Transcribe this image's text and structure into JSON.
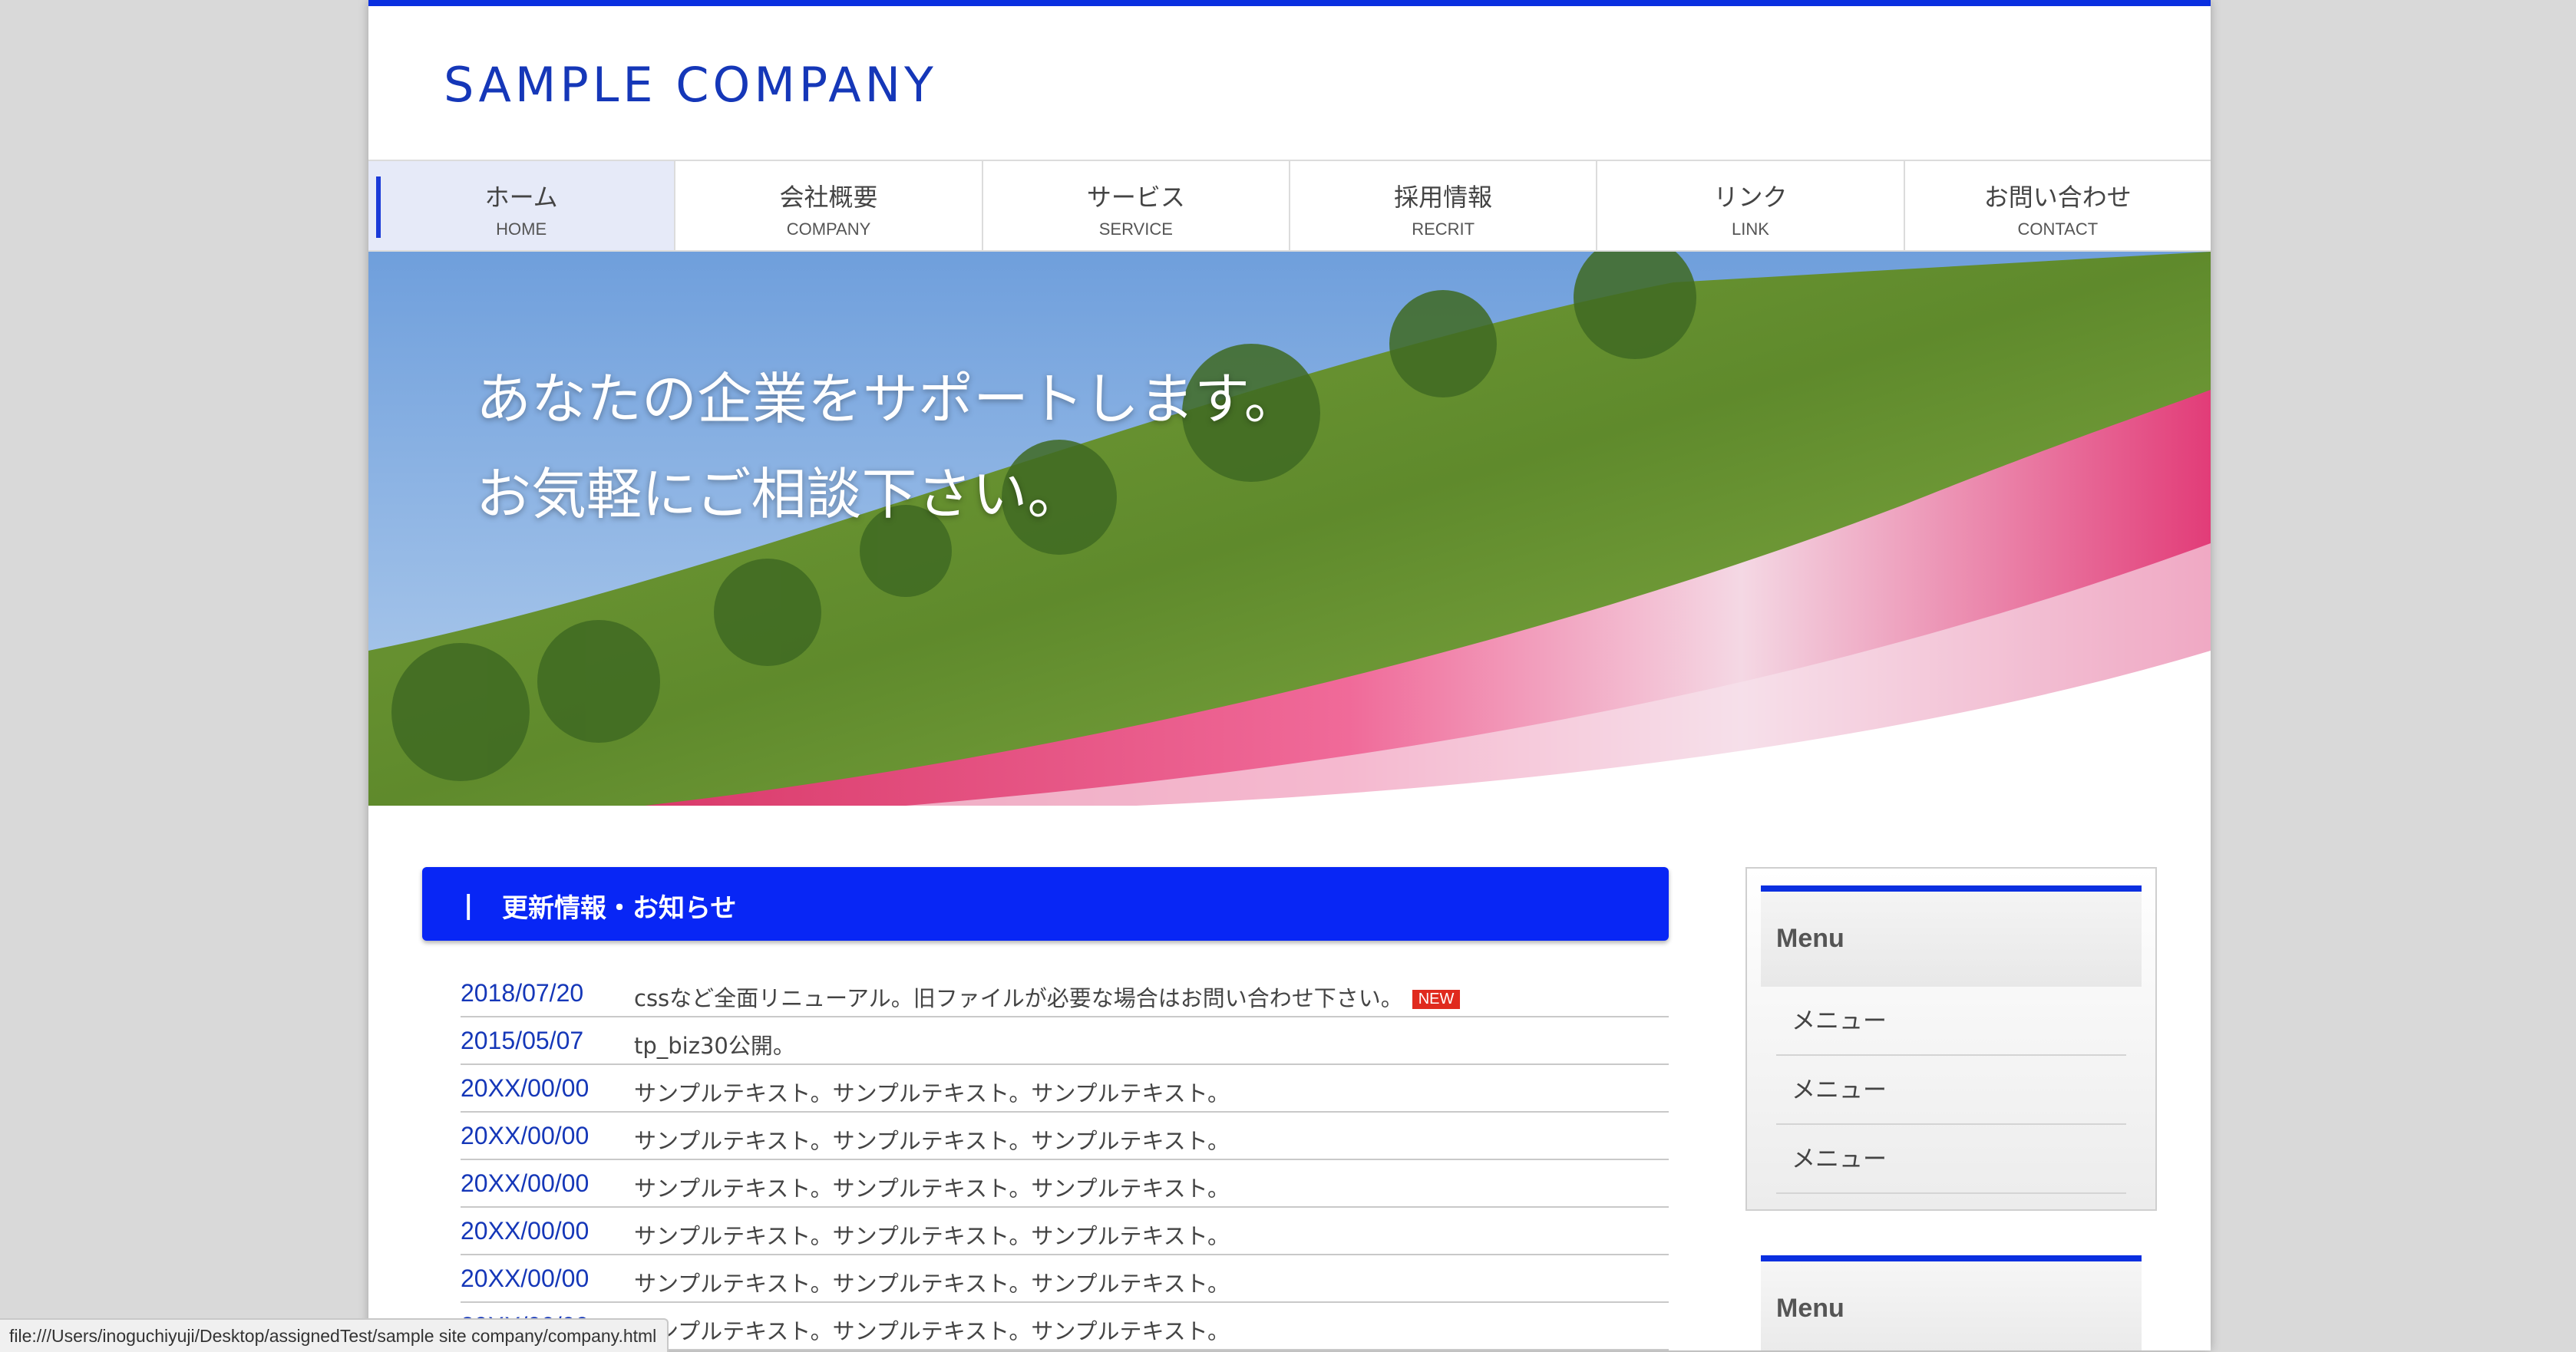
{
  "brand": {
    "logo": "SAMPLE COMPANY",
    "accent_color": "#0a2fe0",
    "text_blue": "#1537b8"
  },
  "nav": [
    {
      "jp": "ホーム",
      "en": "HOME",
      "active": true
    },
    {
      "jp": "会社概要",
      "en": "COMPANY"
    },
    {
      "jp": "サービス",
      "en": "SERVICE"
    },
    {
      "jp": "採用情報",
      "en": "RECRIT"
    },
    {
      "jp": "リンク",
      "en": "LINK"
    },
    {
      "jp": "お問い合わせ",
      "en": "CONTACT"
    }
  ],
  "hero": {
    "line1": "あなたの企業をサポートします。",
    "line2": "お気軽にご相談下さい。"
  },
  "news": {
    "bar": "|",
    "title": "更新情報・お知らせ",
    "new_badge": "NEW",
    "items": [
      {
        "date": "2018/07/20",
        "text": "cssなど全面リニューアル。旧ファイルが必要な場合はお問い合わせ下さい。"
      },
      {
        "date": "2015/05/07",
        "text": "tp_biz30公開。"
      },
      {
        "date": "20XX/00/00",
        "text": "サンプルテキスト。サンプルテキスト。サンプルテキスト。"
      },
      {
        "date": "20XX/00/00",
        "text": "サンプルテキスト。サンプルテキスト。サンプルテキスト。"
      },
      {
        "date": "20XX/00/00",
        "text": "サンプルテキスト。サンプルテキスト。サンプルテキスト。"
      },
      {
        "date": "20XX/00/00",
        "text": "サンプルテキスト。サンプルテキスト。サンプルテキスト。"
      },
      {
        "date": "20XX/00/00",
        "text": "サンプルテキスト。サンプルテキスト。サンプルテキスト。"
      },
      {
        "date": "20XX/00/00",
        "text": "サンプルテキスト。サンプルテキスト。サンプルテキスト。"
      }
    ]
  },
  "sidebar": {
    "box1": {
      "title": "Menu",
      "items": [
        "メニュー",
        "メニュー",
        "メニュー"
      ]
    },
    "box2": {
      "title": "Menu"
    }
  },
  "status_bar": {
    "url": "file:///Users/inoguchiyuji/Desktop/assignedTest/sample site company/company.html"
  }
}
